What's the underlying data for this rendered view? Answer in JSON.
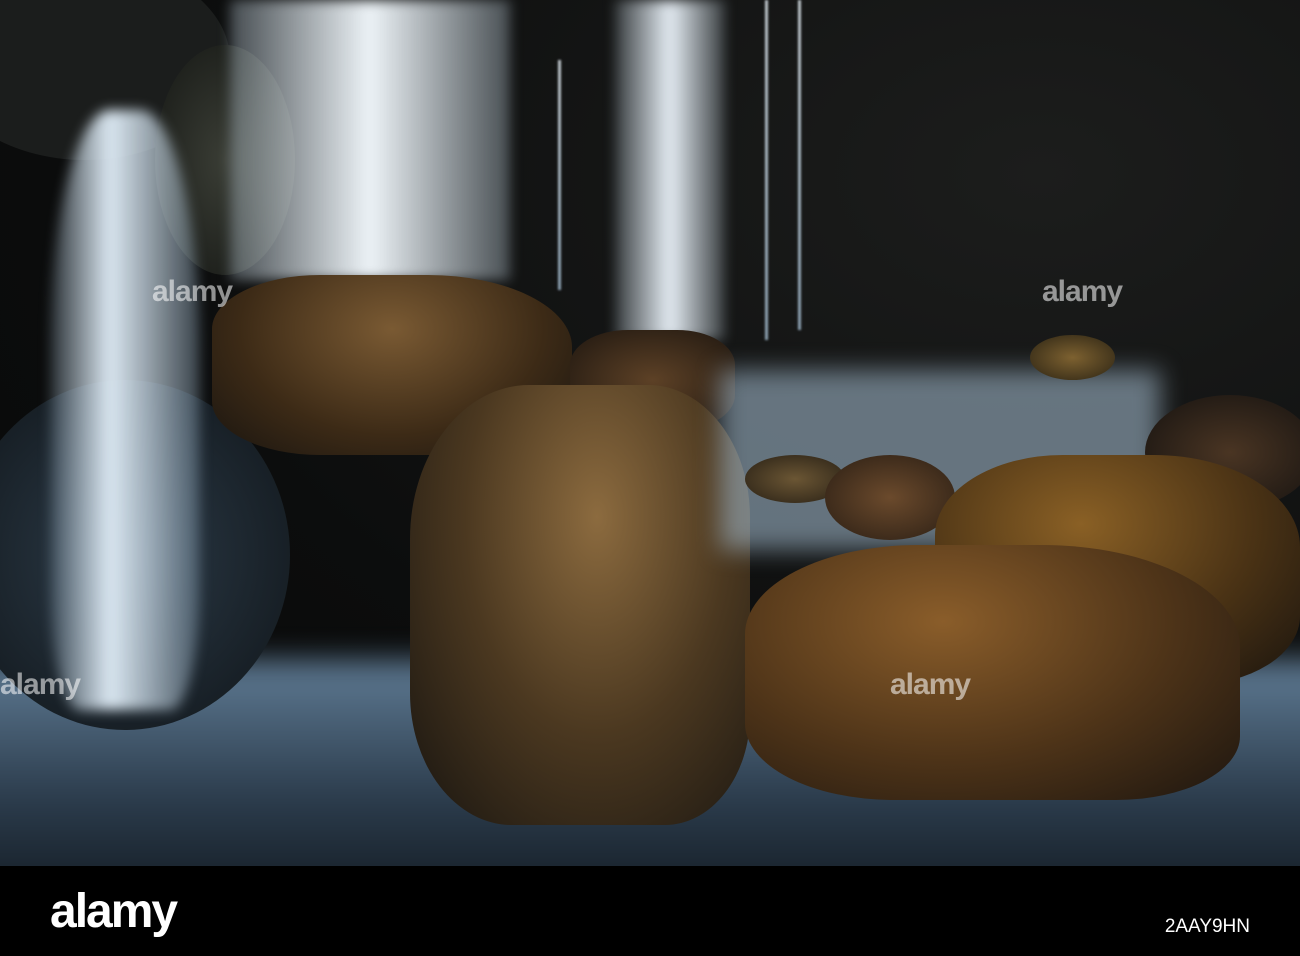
{
  "watermark": {
    "text": "alamy"
  },
  "footer": {
    "logo": "alamy",
    "image_id": "2AAY9HN"
  }
}
